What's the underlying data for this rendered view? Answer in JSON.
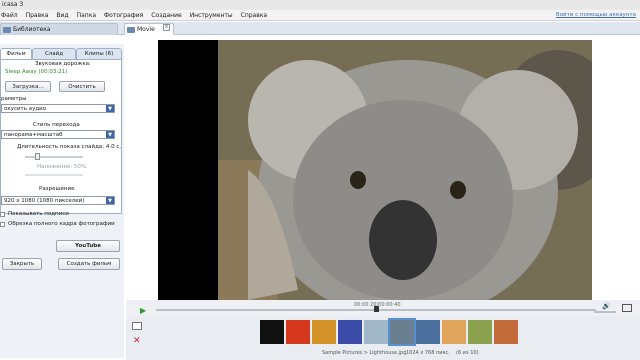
{
  "window": {
    "title": "icasa 3"
  },
  "menu": {
    "items": [
      "Файл",
      "Правка",
      "Вид",
      "Папка",
      "Фотография",
      "Создание",
      "Инструменты",
      "Справка"
    ],
    "signin": "Войти с помощью аккаунта"
  },
  "tabs": {
    "library": "Библиотека",
    "moviemaker": "Movie Maker"
  },
  "panel": {
    "tabs": [
      "Фильм",
      "Слайд",
      "Клипы (6)"
    ],
    "audio_title": "Звуковая дорожка:",
    "audio_track": "Sleep Away (00:03:21)",
    "load_button": "Загрузка...",
    "clear_button": "Очистить",
    "params_label": "раметры",
    "audio_option": "окусить аудио",
    "transition_label": "Стиль перехода",
    "transition_value": "панорама+масштаб",
    "duration_label": "Длительность показа слайда: 4.0 с.",
    "overlap_label": "Наложение: 50%",
    "resolution_label": "Разрешение",
    "resolution_value": "920 x 1080 (1080 пикселей)",
    "show_captions": "Показывать подписи",
    "crop_full": "Обрезка полного кадра фотографии"
  },
  "actions": {
    "youtube": "YouTube",
    "close": "Закрыть",
    "create": "Создать фильм"
  },
  "player": {
    "time": "00:00:20/00:00:40",
    "progress": 0.5,
    "volume": 0.75
  },
  "status": {
    "path": "Sample Pictures > Lighthouse.jpg",
    "dims": "1024 x 768 пикс.",
    "count": "(6 из 10)"
  },
  "colors": {
    "accent": "#3e66a6",
    "youtube_red": "#cc181e",
    "play_green": "#2e9a2e",
    "delete_red": "#c62828"
  }
}
